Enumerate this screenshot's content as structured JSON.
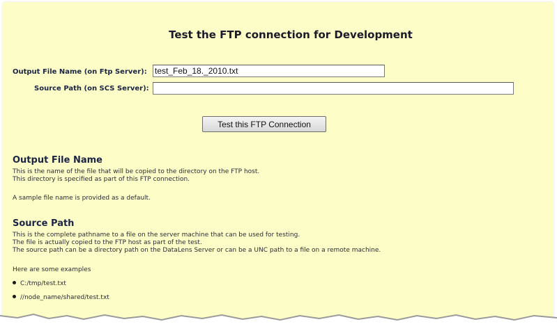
{
  "page": {
    "title": "Test the FTP connection for Development"
  },
  "form": {
    "output_file_label": "Output File Name (on Ftp Server):",
    "output_file_value": "test_Feb_18._2010.txt",
    "source_path_label": "Source Path (on SCS Server):",
    "source_path_value": "",
    "test_button_label": "Test this FTP Connection"
  },
  "help": {
    "output_file": {
      "heading": "Output File Name",
      "lines": [
        "This is the name of the file that will be copied to the directory on the FTP host.",
        "This directory is specified as part of this FTP connection."
      ],
      "note": "A sample file name is provided as a default."
    },
    "source_path": {
      "heading": "Source Path",
      "lines": [
        "This is the complete pathname to a file on the server machine that can be used for testing.",
        "The file is actually copied to the FTP host as part of the test.",
        "The source path can be a directory path on the DataLens Server or can be a UNC path to a file on a remote machine."
      ],
      "examples_intro": "Here are some examples",
      "examples": [
        "C:/tmp/test.txt",
        "//node_name/shared/test.txt"
      ]
    }
  },
  "colors": {
    "panel_background": "#fdfdc7",
    "heading_text": "#1a2444",
    "body_text": "#2a2a33"
  }
}
